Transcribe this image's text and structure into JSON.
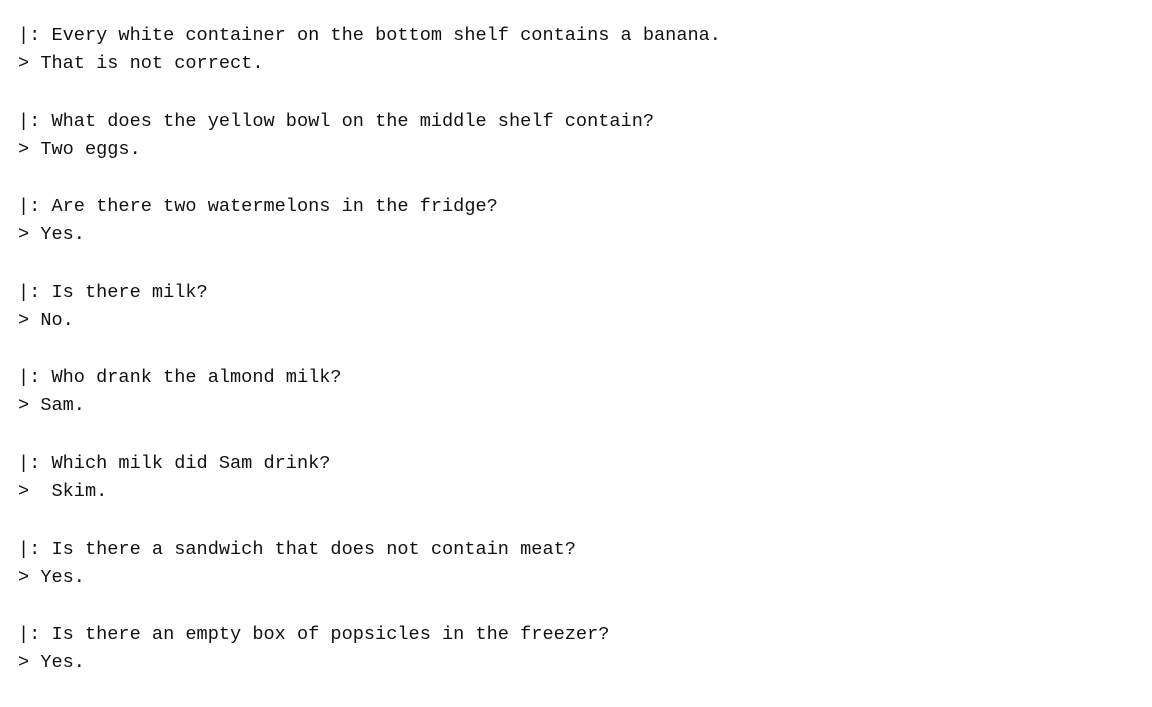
{
  "dialogue": [
    {
      "question_prefix": "|: ",
      "question": "Every white container on the bottom shelf contains a banana.",
      "answer_prefix": "> ",
      "answer": "That is not correct."
    },
    {
      "question_prefix": "|: ",
      "question": "What does the yellow bowl on the middle shelf contain?",
      "answer_prefix": "> ",
      "answer": "Two eggs."
    },
    {
      "question_prefix": "|: ",
      "question": "Are there two watermelons in the fridge?",
      "answer_prefix": "> ",
      "answer": "Yes."
    },
    {
      "question_prefix": "|: ",
      "question": "Is there milk?",
      "answer_prefix": "> ",
      "answer": "No."
    },
    {
      "question_prefix": "|: ",
      "question": "Who drank the almond milk?",
      "answer_prefix": "> ",
      "answer": "Sam."
    },
    {
      "question_prefix": "|: ",
      "question": "Which milk did Sam drink?",
      "answer_prefix": ">  ",
      "answer": "Skim."
    },
    {
      "question_prefix": "|: ",
      "question": "Is there a sandwich that does not contain meat?",
      "answer_prefix": "> ",
      "answer": "Yes."
    },
    {
      "question_prefix": "|: ",
      "question": "Is there an empty box of popsicles in the freezer?",
      "answer_prefix": "> ",
      "answer": "Yes."
    }
  ]
}
